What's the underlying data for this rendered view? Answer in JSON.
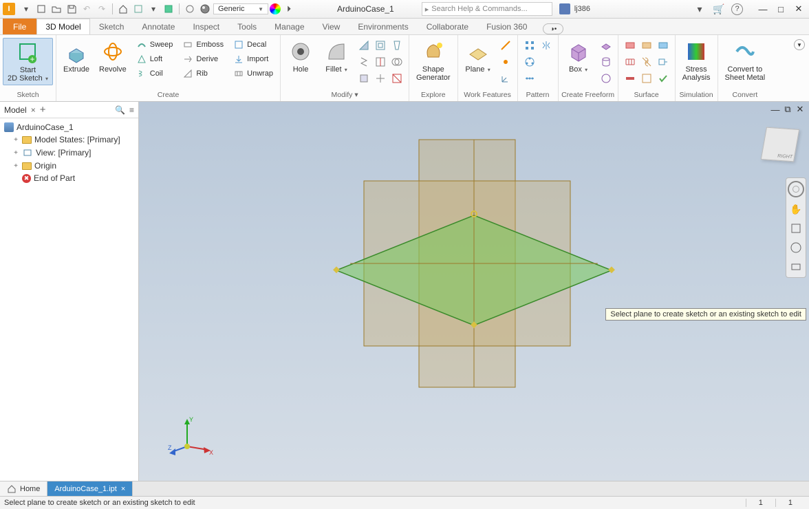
{
  "app": {
    "letter": "I"
  },
  "qat": {
    "material": "Generic"
  },
  "document": {
    "title": "ArduinoCase_1",
    "file_tab": "ArduinoCase_1.ipt"
  },
  "search": {
    "placeholder": "Search Help & Commands...",
    "prefix": "▸"
  },
  "user": {
    "name": "lj386"
  },
  "tabs": {
    "file": "File",
    "items": [
      "3D Model",
      "Sketch",
      "Annotate",
      "Inspect",
      "Tools",
      "Manage",
      "View",
      "Environments",
      "Collaborate",
      "Fusion 360"
    ],
    "active": 0
  },
  "ribbon": {
    "groups": {
      "sketch": {
        "label": "Sketch",
        "start": "Start\n2D Sketch"
      },
      "create": {
        "label": "Create",
        "extrude": "Extrude",
        "revolve": "Revolve",
        "sweep": "Sweep",
        "loft": "Loft",
        "coil": "Coil",
        "emboss": "Emboss",
        "derive": "Derive",
        "rib": "Rib",
        "decal": "Decal",
        "import": "Import",
        "unwrap": "Unwrap"
      },
      "modify": {
        "label": "Modify  ▾",
        "hole": "Hole",
        "fillet": "Fillet"
      },
      "explore": {
        "label": "Explore",
        "shape": "Shape\nGenerator"
      },
      "workfeatures": {
        "label": "Work Features",
        "plane": "Plane"
      },
      "pattern": {
        "label": "Pattern"
      },
      "freeform": {
        "label": "Create Freeform",
        "box": "Box"
      },
      "surface": {
        "label": "Surface"
      },
      "simulation": {
        "label": "Simulation",
        "stress": "Stress\nAnalysis"
      },
      "convert": {
        "label": "Convert",
        "sheet": "Convert to\nSheet Metal"
      }
    }
  },
  "browser": {
    "title": "Model",
    "root": "ArduinoCase_1",
    "nodes": {
      "modelstates": "Model States: [Primary]",
      "view": "View: [Primary]",
      "origin": "Origin",
      "end": "End of Part"
    }
  },
  "viewport": {
    "tooltip": "Select plane to create sketch or an existing sketch to edit",
    "cube": "RIGHT"
  },
  "doctabs": {
    "home": "Home"
  },
  "status": {
    "message": "Select plane to create sketch or an existing sketch to edit",
    "num1": "1",
    "num2": "1"
  }
}
